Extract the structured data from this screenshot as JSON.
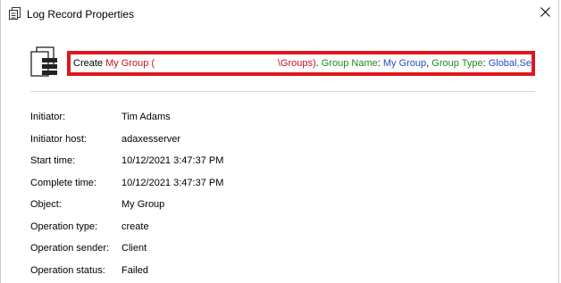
{
  "window": {
    "title": "Log Record Properties"
  },
  "description": {
    "colors": {
      "plain": "#000000",
      "object": "#c0171e",
      "property": "#1e8a1e",
      "value": "#1f4fc4"
    },
    "segments": [
      {
        "text": "Create ",
        "role": "plain"
      },
      {
        "text": "My Group (",
        "role": "object"
      },
      {
        "gap": true,
        "role": "object"
      },
      {
        "text": "\\Groups)",
        "role": "object"
      },
      {
        "text": ". ",
        "role": "plain"
      },
      {
        "text": "Group Name",
        "role": "property"
      },
      {
        "text": ": ",
        "role": "plain"
      },
      {
        "text": "My Group",
        "role": "value"
      },
      {
        "text": ", ",
        "role": "plain"
      },
      {
        "text": "Group Type",
        "role": "property"
      },
      {
        "text": ": ",
        "role": "plain"
      },
      {
        "text": "Global,Se",
        "role": "value"
      }
    ]
  },
  "properties": [
    {
      "label": "Initiator:",
      "value": "Tim Adams"
    },
    {
      "label": "Initiator host:",
      "value": "adaxesserver"
    },
    {
      "label": "Start time:",
      "value": "10/12/2021 3:47:37 PM"
    },
    {
      "label": "Complete time:",
      "value": "10/12/2021 3:47:37 PM"
    },
    {
      "label": "Object:",
      "value": "My Group"
    },
    {
      "label": "Operation type:",
      "value": "create"
    },
    {
      "label": "Operation sender:",
      "value": "Client"
    },
    {
      "label": "Operation status:",
      "value": "Failed"
    }
  ],
  "icons": {
    "title": "log-record-icon",
    "close": "close-icon",
    "record": "record-stack-icon"
  }
}
